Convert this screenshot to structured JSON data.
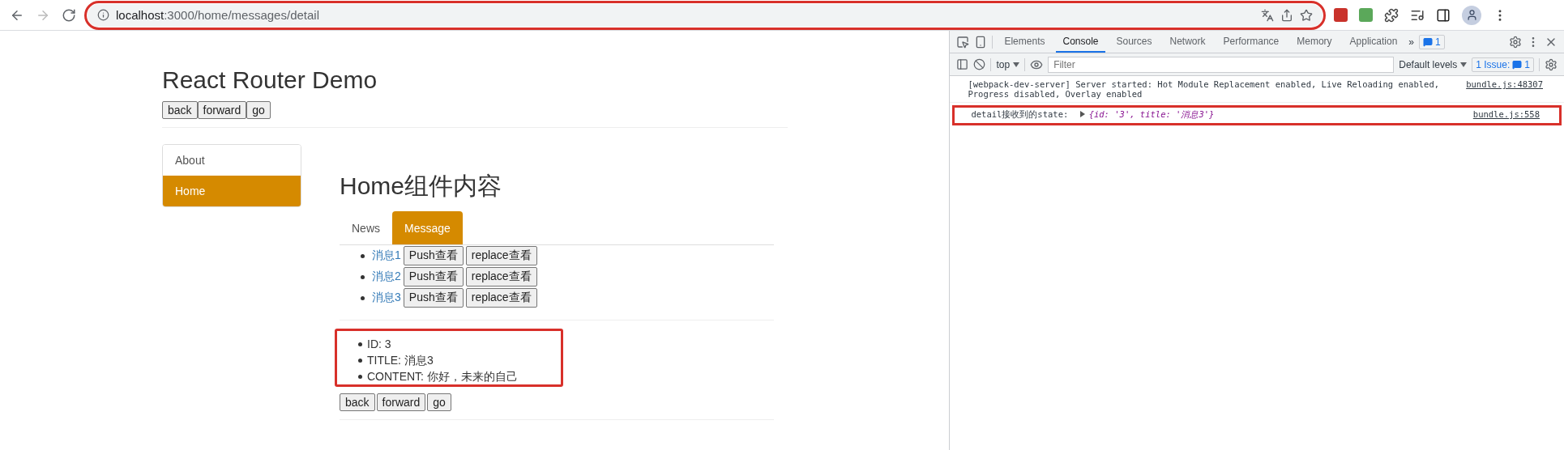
{
  "browser": {
    "url_host": "localhost",
    "url_path": ":3000/home/messages/detail",
    "url_highlighted": true
  },
  "page": {
    "title": "React Router Demo",
    "history_buttons": [
      "back",
      "forward",
      "go"
    ],
    "nav": [
      {
        "label": "About",
        "selected": false
      },
      {
        "label": "Home",
        "selected": true
      }
    ],
    "heading": "Home组件内容",
    "tabs": [
      {
        "label": "News",
        "selected": false
      },
      {
        "label": "Message",
        "selected": true
      }
    ],
    "messages": [
      {
        "link": "消息1",
        "push": "Push查看",
        "replace": "replace查看"
      },
      {
        "link": "消息2",
        "push": "Push查看",
        "replace": "replace查看"
      },
      {
        "link": "消息3",
        "push": "Push查看",
        "replace": "replace查看"
      }
    ],
    "detail": {
      "highlighted": true,
      "items": [
        "ID: 3",
        "TITLE: 消息3",
        "CONTENT: 你好，未来的自己"
      ]
    },
    "detail_buttons": [
      "back",
      "forward",
      "go"
    ]
  },
  "devtools": {
    "tabs": [
      {
        "label": "Elements",
        "selected": false
      },
      {
        "label": "Console",
        "selected": true
      },
      {
        "label": "Sources",
        "selected": false
      },
      {
        "label": "Network",
        "selected": false
      },
      {
        "label": "Performance",
        "selected": false
      },
      {
        "label": "Memory",
        "selected": false
      },
      {
        "label": "Application",
        "selected": false
      }
    ],
    "more_tabs": "»",
    "issues_badge": "1",
    "context": "top",
    "filter_placeholder": "Filter",
    "levels": "Default levels",
    "issues_label": "1 Issue:",
    "issues_count": "1",
    "messages": [
      {
        "text": "[webpack-dev-server] Server started: Hot Module Replacement enabled, Live Reloading enabled, Progress disabled, Overlay enabled",
        "source": "bundle.js:48307",
        "highlighted": false
      },
      {
        "text": "detail接收到的state: ",
        "object": "{id: '3', title: '消息3'}",
        "source": "bundle.js:558",
        "highlighted": true
      }
    ]
  }
}
